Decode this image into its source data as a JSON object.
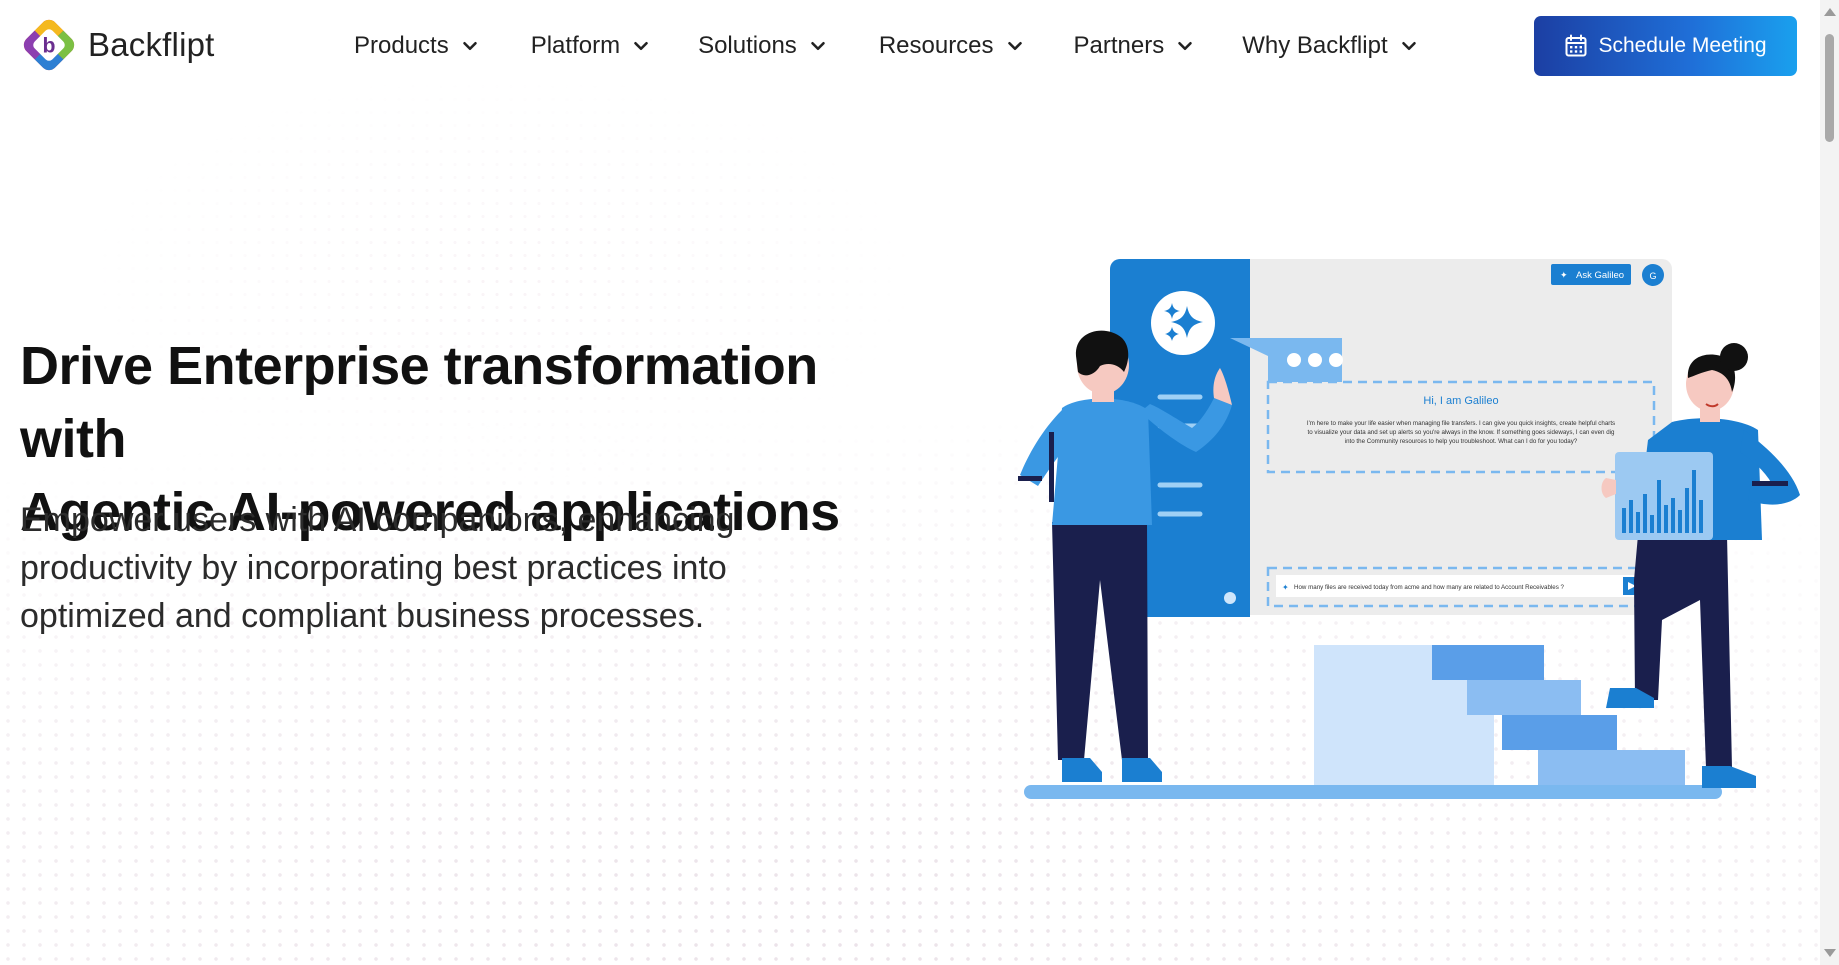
{
  "brand": {
    "name": "Backflipt"
  },
  "nav": {
    "items": [
      {
        "label": "Products"
      },
      {
        "label": "Platform"
      },
      {
        "label": "Solutions"
      },
      {
        "label": "Resources"
      },
      {
        "label": "Partners"
      },
      {
        "label": "Why Backflipt"
      }
    ]
  },
  "cta": {
    "label": "Schedule Meeting",
    "icon": "calendar-icon"
  },
  "hero": {
    "title_line1": "Drive Enterprise transformation with",
    "title_line2": "Agentic AI-powered applications",
    "subtitle_line1": "Empower users with AI companions, enhancing",
    "subtitle_line2": "productivity by incorporating best practices into",
    "subtitle_line3": "optimized and compliant business processes."
  },
  "illustration": {
    "ask_button": "Ask Galileo",
    "avatar_initial": "G",
    "greeting": "Hi, I am Galileo",
    "message_line1": "I'm here to make your life easier when managing file transfers. I can give you quick insights, create helpful charts",
    "message_line2": "to visualize your data and set up alerts so you're always in the know. If something goes sideways, I can even dig",
    "message_line3": "into the Community resources to help you troubleshoot. What can I do for you today?",
    "query": "How many files are received today from acme and how many are related to Account Receivables ?"
  },
  "colors": {
    "primary_blue": "#1b7fd1",
    "navy": "#1a1f4d",
    "cta_start": "#1c3fa3",
    "cta_end": "#1aa0ee"
  }
}
